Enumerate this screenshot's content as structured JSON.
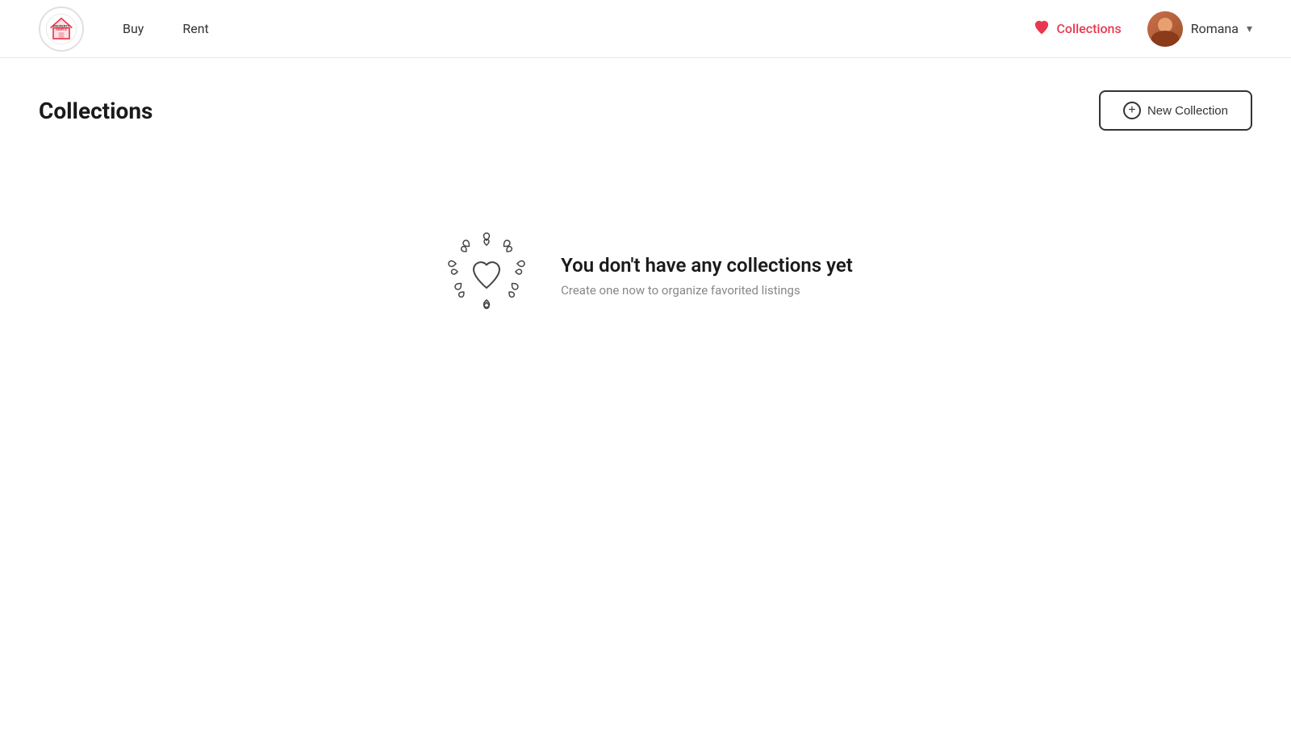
{
  "header": {
    "logo_alt": "Property Simple",
    "nav": {
      "buy_label": "Buy",
      "rent_label": "Rent"
    },
    "collections_label": "Collections",
    "user": {
      "name": "Romana",
      "chevron": "▾"
    }
  },
  "page": {
    "title": "Collections",
    "new_collection_btn": "New Collection",
    "empty_state": {
      "heading": "You don't have any collections yet",
      "subtext": "Create one now to organize favorited listings"
    }
  }
}
